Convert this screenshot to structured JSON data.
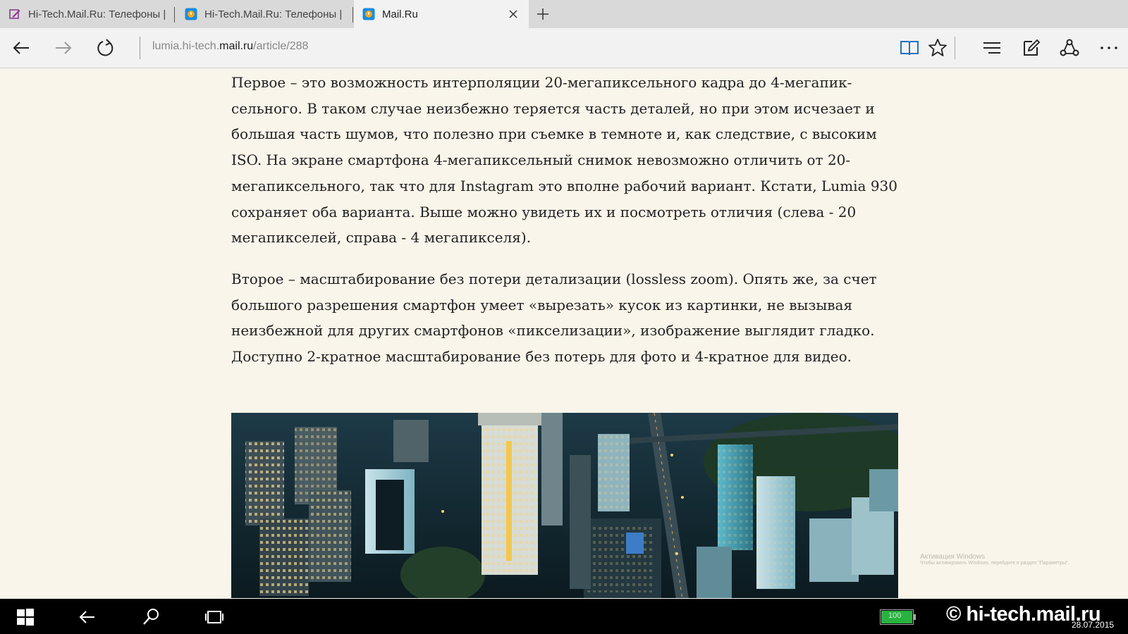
{
  "tabs": [
    {
      "title": "Hi-Tech.Mail.Ru: Телефоны |",
      "icon": "note-edit-icon",
      "active": false
    },
    {
      "title": "Hi-Tech.Mail.Ru: Телефоны |",
      "icon": "mail-ru-icon",
      "active": false
    },
    {
      "title": "Mail.Ru",
      "icon": "mail-ru-icon",
      "active": true
    }
  ],
  "address": {
    "url_prefix": "lumia.hi-tech.",
    "url_domain": "mail.ru",
    "url_path": "/article/288"
  },
  "article": {
    "paragraphs": [
      "Первое – это возможность интерполяции 20-мегапиксельного кадра до 4-мегапик­сельного. В таком случае неизбежно теряется часть деталей, но при этом исчезает и большая часть шумов, что полезно при съемке в темноте и, как следствие, с высоким ISO. На экране смартфона 4-мегапиксельный снимок невозможно отли­чить от 20-мегапиксельного, так что для Instagram это вполне рабочий вариант. Кстати, Lumia 930 сохраняет оба варианта. Выше можно увидеть их и посмотреть отличия (слева - 20 мегапикселей, справа - 4 мегапикселя).",
      "Второе – масштабирование без потери детализации (lossless zoom). Опять же, за счет большого разрешения смартфон умеет «вырезать» кусок из картинки, не вызывая неизбежной для других смартфонов «пикселизации», изображение выглядит гладко. Доступно 2-кратное масштабирование без потерь для фото и 4-кратное для видео."
    ]
  },
  "watermark": {
    "title": "Активация Windows",
    "subtitle": "Чтобы активировать Windows, перейдите в раздел \"Параметры\"."
  },
  "taskbar": {
    "battery_percent": "100",
    "battery_level": 1.0,
    "tray_logo": "© hi-tech.mail.ru",
    "date": "28.07.2015"
  },
  "colors": {
    "page_background": "#f9f5ea",
    "tabbar": "#d9d9d9",
    "toolbar": "#f2f2f2",
    "reading_view_active": "#1e73be",
    "battery": "#27b33e",
    "taskbar": "#000000"
  }
}
